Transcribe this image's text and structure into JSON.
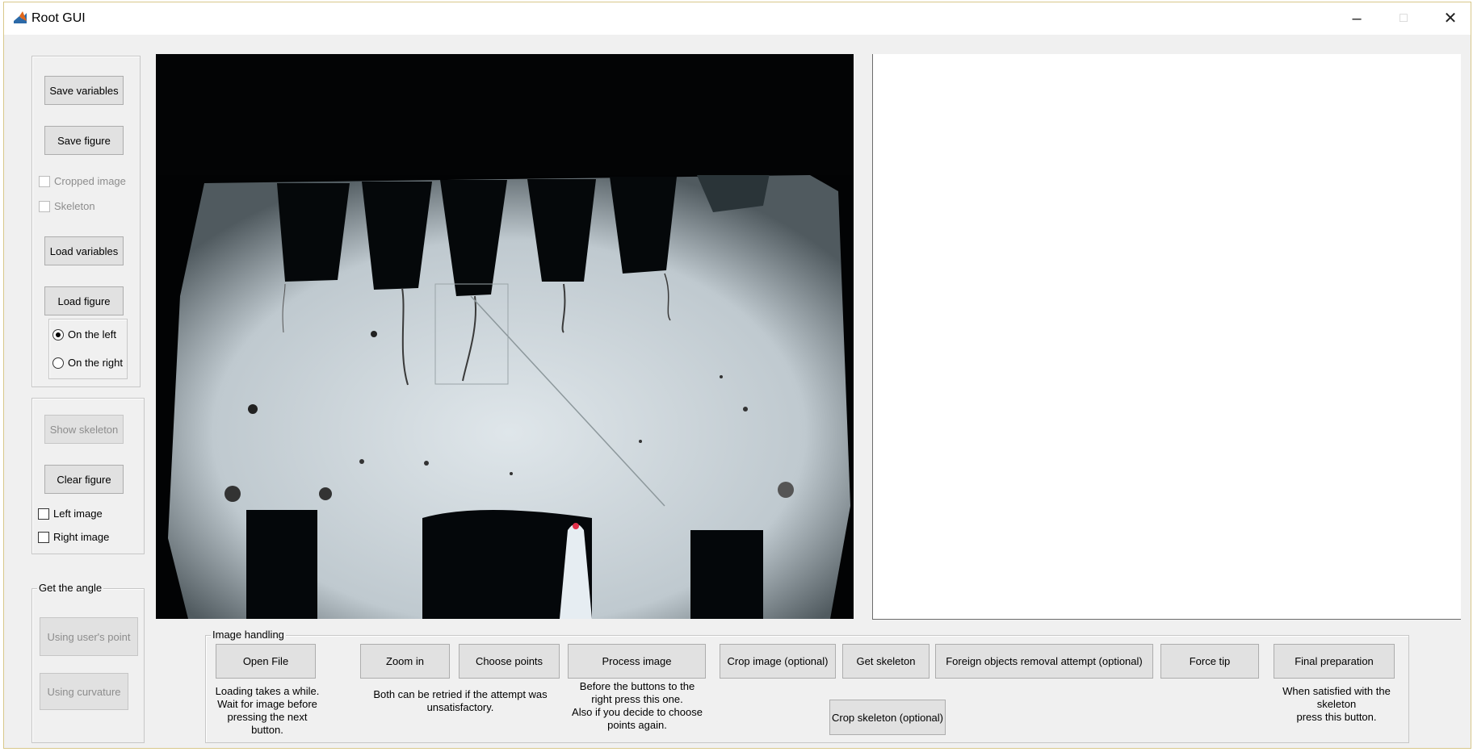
{
  "window": {
    "title": "Root GUI"
  },
  "left_panel": {
    "save_variables": "Save variables",
    "save_figure": "Save figure",
    "cropped_image": "Cropped image",
    "skeleton": "Skeleton",
    "load_variables": "Load variables",
    "load_figure": "Load figure",
    "on_the_left": "On the left",
    "on_the_right": "On the right",
    "on_the_left_selected": true
  },
  "display_panel": {
    "show_skeleton": "Show skeleton",
    "clear_figure": "Clear figure",
    "left_image": "Left image",
    "right_image": "Right image"
  },
  "angle_panel": {
    "title": "Get the angle",
    "using_users_point": "Using user's point",
    "using_curvature": "Using curvature"
  },
  "image_handling": {
    "title": "Image handling",
    "open_file": "Open File",
    "open_file_hint": [
      "Loading takes a while.",
      "Wait for  image before",
      "pressing the next button."
    ],
    "zoom_in": "Zoom in",
    "choose_points": "Choose points",
    "zoom_hint": [
      "Both can be retried if the attempt was",
      "unsatisfactory."
    ],
    "process_image": "Process image",
    "process_hint": [
      "Before the buttons to the",
      "right press this one.",
      "Also if you decide to choose",
      "points again."
    ],
    "crop_image": "Crop image (optional)",
    "get_skeleton": "Get skeleton",
    "foreign_objects": "Foreign objects removal attempt (optional)",
    "crop_skeleton": "Crop skeleton (optional)",
    "force_tip": "Force tip",
    "final_preparation": "Final preparation",
    "final_hint": [
      "When satisfied with the",
      "skeleton",
      "press this button."
    ]
  },
  "icons": {
    "app": "matlab-logo-icon",
    "minimize": "minimize-icon",
    "maximize": "maximize-icon",
    "close": "close-icon"
  },
  "colors": {
    "accent": "#e0661a",
    "axes_bg": "#ffffff",
    "photo_bg": "#000000"
  }
}
